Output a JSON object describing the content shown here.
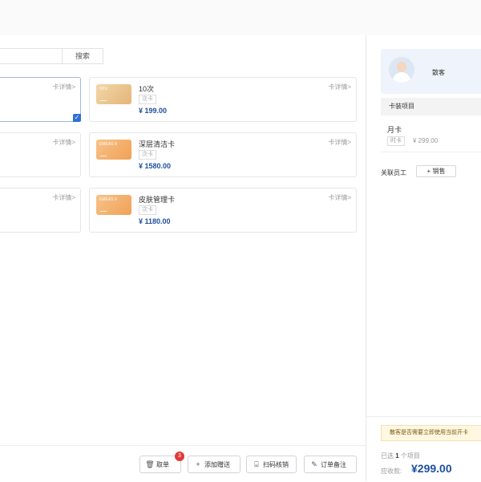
{
  "search": {
    "button_label": "搜索"
  },
  "cards": [
    {
      "name": "",
      "tag": "",
      "price": "",
      "detail": "卡详情>",
      "selected": true
    },
    {
      "name": "10次",
      "tag": "次卡",
      "price": "¥ 199.00",
      "detail": "卡详情>",
      "thumb_label": "SKU",
      "thumb_color": "gold"
    },
    {
      "name": "",
      "tag": "",
      "price": "",
      "detail": "卡详情>"
    },
    {
      "name": "深层清洁卡",
      "tag": "次卡",
      "price": "¥ 1580.00",
      "detail": "卡详情>",
      "thumb_label": "EMEAS 9",
      "thumb_color": "orange"
    },
    {
      "name": "",
      "tag": "",
      "price": "",
      "detail": "卡详情>"
    },
    {
      "name": "皮肤管理卡",
      "tag": "次卡",
      "price": "¥ 1180.00",
      "detail": "卡详情>",
      "thumb_label": "EMEAS 9",
      "thumb_color": "orange"
    }
  ],
  "actions": {
    "cancel": {
      "label": "取单",
      "icon": "trash-icon",
      "badge": "3"
    },
    "add_gift": {
      "label": "添加赠送",
      "icon": "plus-icon"
    },
    "scan": {
      "label": "扫码核销",
      "icon": "scan-icon"
    },
    "note": {
      "label": "订单备注",
      "icon": "edit-icon"
    }
  },
  "member": {
    "name": "散客"
  },
  "section": {
    "title": "卡装项目",
    "item": {
      "name": "月卡",
      "tag": "时卡",
      "price": "¥ 299.00"
    }
  },
  "staff": {
    "label": "关联员工",
    "button": "+ 销售"
  },
  "notice": "散客是否需要立即使用当前开卡",
  "summary": {
    "selected_prefix": "已选",
    "selected_count": "1",
    "selected_suffix": "个项目",
    "total_label": "应收款:",
    "total_value": "¥299.00"
  },
  "colors": {
    "accent": "#1e4fa0",
    "primary_blue": "#2f6fd6",
    "badge_red": "#e03a3a"
  }
}
